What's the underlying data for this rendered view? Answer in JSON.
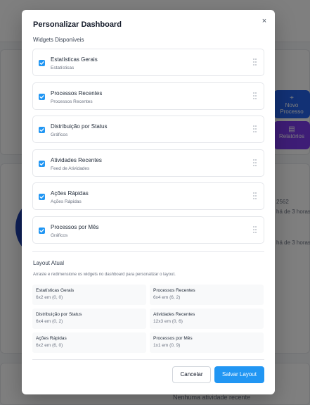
{
  "background": {
    "tile_new_label": "Novo Processo",
    "tile_new_glyph": "+",
    "tile_reports_label": "Relatórios",
    "tile_reports_glyph": "▤",
    "snippet_year": "2562",
    "snippet_time_1": "há de 3 horas",
    "snippet_time_2": "há de 3 horas",
    "no_activity": "Nenhuma atividade recente"
  },
  "modal": {
    "title": "Personalizar Dashboard",
    "close_glyph": "×",
    "widgets_label": "Widgets Disponíveis",
    "widgets": [
      {
        "title": "Estatísticas Gerais",
        "subtitle": "Estatísticas",
        "checked": true
      },
      {
        "title": "Processos Recentes",
        "subtitle": "Processos Recentes",
        "checked": true
      },
      {
        "title": "Distribuição por Status",
        "subtitle": "Gráficos",
        "checked": true
      },
      {
        "title": "Atividades Recentes",
        "subtitle": "Feed de Atividades",
        "checked": true
      },
      {
        "title": "Ações Rápidas",
        "subtitle": "Ações Rápidas",
        "checked": true
      },
      {
        "title": "Processos por Mês",
        "subtitle": "Gráficos",
        "checked": true
      }
    ],
    "layout_label": "Layout Atual",
    "layout_description": "Arraste e redimensione os widgets no dashboard para personalizar o layout.",
    "layout_items": [
      {
        "name": "Estatísticas Gerais",
        "position": "6x2 em (0, 0)"
      },
      {
        "name": "Processos Recentes",
        "position": "6x4 em (6, 2)"
      },
      {
        "name": "Distribuição por Status",
        "position": "6x4 em (0, 2)"
      },
      {
        "name": "Atividades Recentes",
        "position": "12x3 em (0, 6)"
      },
      {
        "name": "Ações Rápidas",
        "position": "6x2 em (6, 0)"
      },
      {
        "name": "Processos por Mês",
        "position": "1x1 em (0, 9)"
      }
    ],
    "cancel_label": "Cancelar",
    "save_label": "Salvar Layout"
  },
  "colors": {
    "accent": "#2196f3",
    "tile_blue": "#2563eb",
    "tile_purple": "#7c3aed",
    "overlay": "rgba(0,0,0,0.5)"
  },
  "icons": {
    "close": "close-icon",
    "checkbox": "checkbox-checked-icon",
    "drag": "drag-handle-icon"
  }
}
